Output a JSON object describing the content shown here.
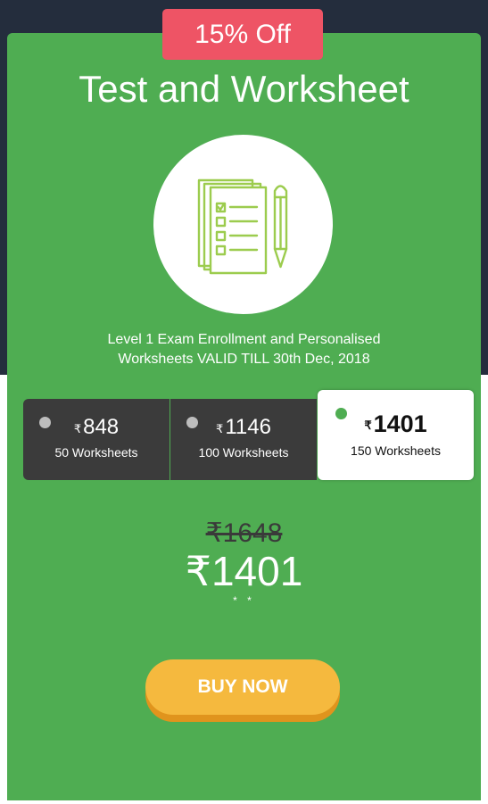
{
  "badge": {
    "label": "15% Off"
  },
  "product": {
    "title": "Test and Worksheet",
    "icon": "worksheet-with-pencil-icon",
    "description_line1": "Level 1 Exam Enrollment and Personalised",
    "description_line2": "Worksheets VALID TILL 30th Dec, 2018"
  },
  "plans": [
    {
      "currency": "₹",
      "price": "848",
      "label": "50 Worksheets",
      "selected": false
    },
    {
      "currency": "₹",
      "price": "1146",
      "label": "100 Worksheets",
      "selected": false
    },
    {
      "currency": "₹",
      "price": "1401",
      "label": "150 Worksheets",
      "selected": true
    }
  ],
  "pricing": {
    "original": "₹1648",
    "current": "₹1401",
    "footnote_marker": "* *"
  },
  "buy_button": {
    "label": "BUY NOW"
  },
  "colors": {
    "card_green": "#4fad52",
    "badge_red": "#ee5465",
    "header_dark": "#242d3d",
    "button_yellow": "#f5b93e",
    "icon_lime": "#9ccc4e"
  }
}
